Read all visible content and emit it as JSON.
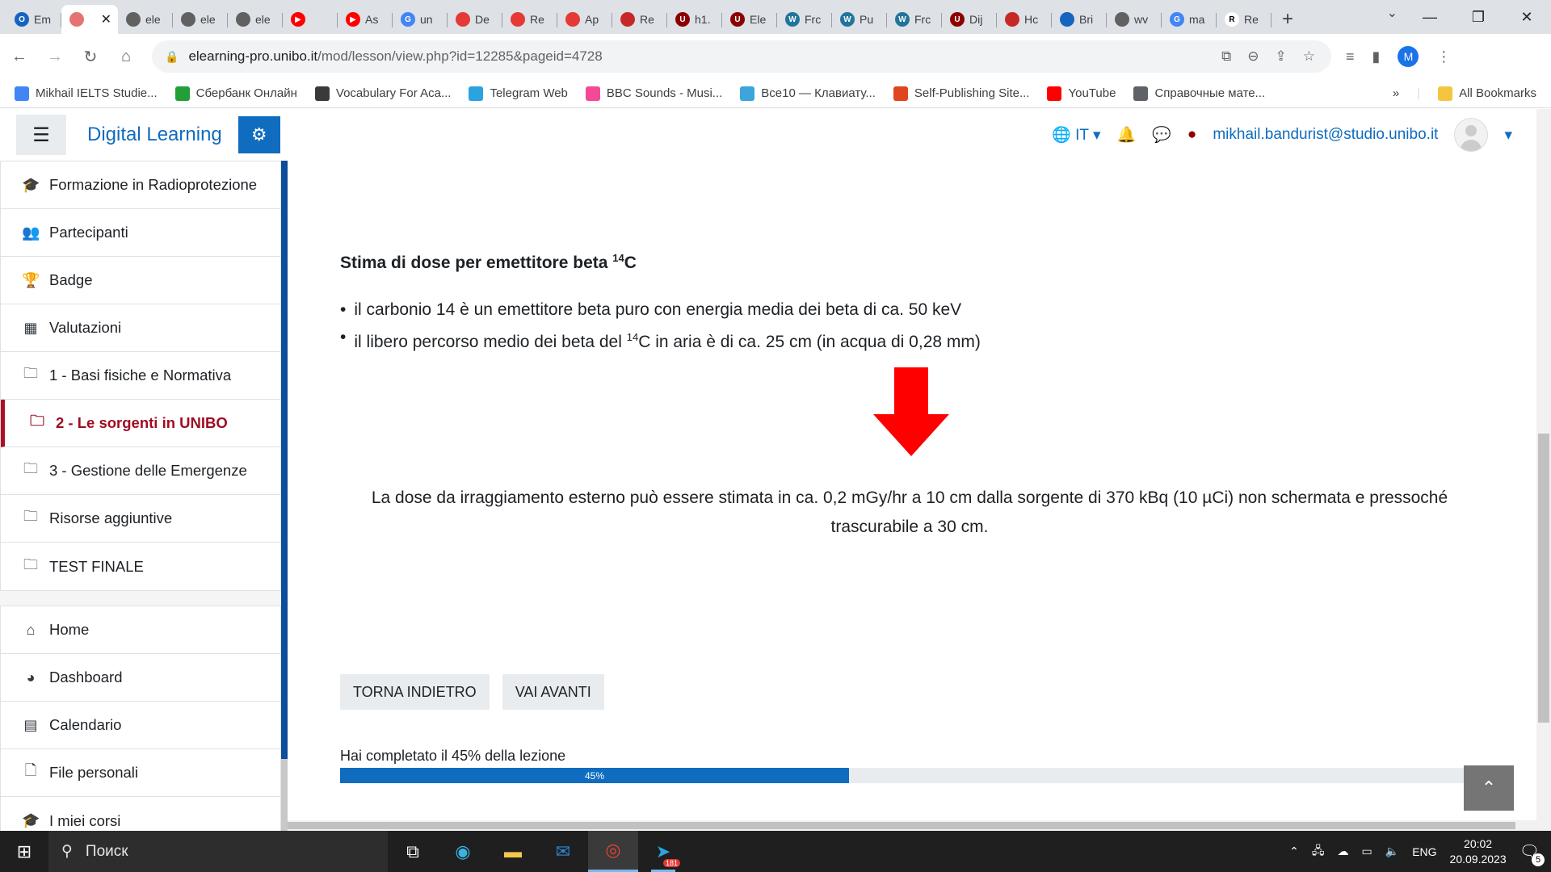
{
  "browser": {
    "tabs": [
      {
        "label": "Em",
        "color": "#1565c0",
        "glyph": "O"
      },
      {
        "label": "",
        "color": "#e57373",
        "glyph": "",
        "active": true
      },
      {
        "label": "ele",
        "color": "#616161",
        "glyph": ""
      },
      {
        "label": "ele",
        "color": "#616161",
        "glyph": ""
      },
      {
        "label": "ele",
        "color": "#616161",
        "glyph": ""
      },
      {
        "label": "",
        "color": "#ff0000",
        "glyph": "▶"
      },
      {
        "label": "As",
        "color": "#ff0000",
        "glyph": "▶"
      },
      {
        "label": "un",
        "color": "#4285f4",
        "glyph": "G"
      },
      {
        "label": "De",
        "color": "#e53935",
        "glyph": ""
      },
      {
        "label": "Re",
        "color": "#e53935",
        "glyph": ""
      },
      {
        "label": "Ap",
        "color": "#e53935",
        "glyph": ""
      },
      {
        "label": "Re",
        "color": "#c62828",
        "glyph": ""
      },
      {
        "label": "h1.",
        "color": "#8b0000",
        "glyph": "U"
      },
      {
        "label": "Ele",
        "color": "#8b0000",
        "glyph": "U"
      },
      {
        "label": "Frc",
        "color": "#21759b",
        "glyph": "W"
      },
      {
        "label": "Pu",
        "color": "#21759b",
        "glyph": "W"
      },
      {
        "label": "Frc",
        "color": "#21759b",
        "glyph": "W"
      },
      {
        "label": "Dij",
        "color": "#8b0000",
        "glyph": "U"
      },
      {
        "label": "Hc",
        "color": "#c62828",
        "glyph": ""
      },
      {
        "label": "Bri",
        "color": "#1565c0",
        "glyph": ""
      },
      {
        "label": "wv",
        "color": "#616161",
        "glyph": ""
      },
      {
        "label": "ma",
        "color": "#4285f4",
        "glyph": "G"
      },
      {
        "label": "Re",
        "color": "#ffffff",
        "glyph": "R"
      }
    ],
    "close_glyph": "✕",
    "new_tab_glyph": "+",
    "tab_search_glyph": "⌄",
    "window_controls": [
      "—",
      "❐",
      "✕"
    ],
    "url_host": "elearning-pro.unibo.it",
    "url_path": "/mod/lesson/view.php?id=12285&pageid=4728",
    "profile_letter": "M",
    "bookmarks": [
      {
        "label": "Mikhail IELTS Studie...",
        "color": "#4285f4"
      },
      {
        "label": "Сбербанк Онлайн",
        "color": "#21a038"
      },
      {
        "label": "Vocabulary For Aca...",
        "color": "#3a3a3a"
      },
      {
        "label": "Telegram Web",
        "color": "#2aa3df"
      },
      {
        "label": "BBC Sounds - Musi...",
        "color": "#f54997"
      },
      {
        "label": "Все10 — Клавиату...",
        "color": "#3da5d9"
      },
      {
        "label": "Self-Publishing Site...",
        "color": "#e0451f"
      },
      {
        "label": "YouTube",
        "color": "#ff0000"
      },
      {
        "label": "Справочные мате...",
        "color": "#5f6368"
      }
    ],
    "bookmarks_overflow": "»",
    "all_bookmarks": "All Bookmarks"
  },
  "navbar": {
    "brand": "Digital Learning",
    "language": "IT",
    "user_email": "mikhail.bandurist@studio.unibo.it"
  },
  "sidebar": {
    "course_items": [
      {
        "label": "Formazione in Radioprotezione",
        "icon": "graduation-cap-icon",
        "glyph": "🎓"
      },
      {
        "label": "Partecipanti",
        "icon": "users-icon",
        "glyph": "👥"
      },
      {
        "label": "Badge",
        "icon": "trophy-icon",
        "glyph": "🏆"
      },
      {
        "label": "Valutazioni",
        "icon": "table-icon",
        "glyph": "▦"
      },
      {
        "label": "1 - Basi fisiche e Normativa",
        "icon": "folder-icon",
        "glyph": "🗀"
      },
      {
        "label": "2 - Le sorgenti in UNIBO",
        "icon": "folder-icon",
        "glyph": "🗀",
        "active": true
      },
      {
        "label": "3 - Gestione delle Emergenze",
        "icon": "folder-icon",
        "glyph": "🗀"
      },
      {
        "label": "Risorse aggiuntive",
        "icon": "folder-icon",
        "glyph": "🗀"
      },
      {
        "label": "TEST FINALE",
        "icon": "folder-icon",
        "glyph": "🗀"
      }
    ],
    "site_items": [
      {
        "label": "Home",
        "icon": "home-icon",
        "glyph": "⌂"
      },
      {
        "label": "Dashboard",
        "icon": "dashboard-icon",
        "glyph": "◕"
      },
      {
        "label": "Calendario",
        "icon": "calendar-icon",
        "glyph": "▤"
      },
      {
        "label": "File personali",
        "icon": "file-icon",
        "glyph": "🗋"
      },
      {
        "label": "I miei corsi",
        "icon": "graduation-cap-icon",
        "glyph": "🎓"
      }
    ]
  },
  "lesson": {
    "title_prefix": "Stima di dose per emettitore beta ",
    "title_sup": "14",
    "title_suffix": "C",
    "bullet_1": "il carbonio 14 è un emettitore beta puro con energia media dei beta di ca. 50 keV",
    "bullet_2_prefix": "il libero percorso medio dei beta del ",
    "bullet_2_sup": "14",
    "bullet_2_suffix": "C in aria è di ca. 25 cm (in acqua di 0,28 mm)",
    "conclusion_line_1": "La dose da irraggiamento esterno può essere stimata in ca. 0,2 mGy/hr a 10 cm dalla sorgente di 370 kBq (10 µCi) non schermata e pressoché",
    "conclusion_line_2": "trascurabile a 30 cm.",
    "arrow_color": "#ff0000",
    "back_button": "TORNA INDIETRO",
    "next_button": "VAI AVANTI",
    "progress_text": "Hai completato il 45% della lezione",
    "progress_percent": 45,
    "progress_label": "45%"
  },
  "taskbar": {
    "search_placeholder": "Поиск",
    "language": "ENG",
    "time": "20:02",
    "date": "20.09.2023",
    "telegram_badge": "181",
    "notifications": "5"
  }
}
